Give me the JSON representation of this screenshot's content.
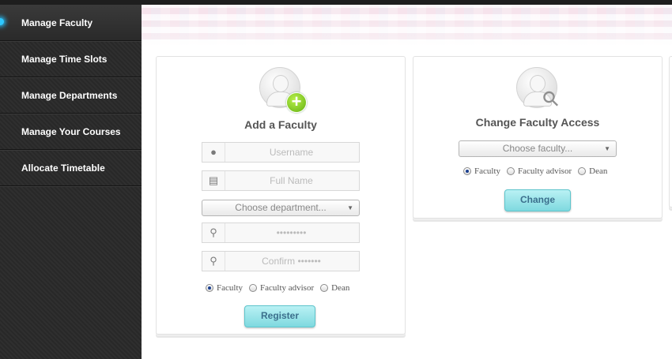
{
  "sidebar": {
    "items": [
      {
        "label": "Manage Faculty",
        "active": true
      },
      {
        "label": "Manage Time Slots"
      },
      {
        "label": "Manage Departments"
      },
      {
        "label": "Manage Your Courses"
      },
      {
        "label": "Allocate Timetable"
      }
    ],
    "active_indicator_color": "#2ec8ff"
  },
  "add_faculty": {
    "title": "Add a Faculty",
    "icons": {
      "avatar": "user-avatar-icon",
      "badge": "plus-icon"
    },
    "username_placeholder": "Username",
    "fullname_placeholder": "Full Name",
    "department_select": "Choose department...",
    "password_placeholder": "•••••••••",
    "confirm_placeholder": "Confirm •••••••",
    "role_options": [
      "Faculty",
      "Faculty advisor",
      "Dean"
    ],
    "selected_role": "Faculty",
    "register_label": "Register"
  },
  "change_access": {
    "title": "Change Faculty Access",
    "icons": {
      "avatar": "user-avatar-icon",
      "badge": "key-icon"
    },
    "faculty_select": "Choose faculty...",
    "role_options": [
      "Faculty",
      "Faculty advisor",
      "Dean"
    ],
    "selected_role": "Faculty",
    "change_label": "Change"
  },
  "colors": {
    "button_bg": "#8fe0e5",
    "button_text": "#3b6f8c",
    "sidebar_bg": "#2a2a2a"
  }
}
